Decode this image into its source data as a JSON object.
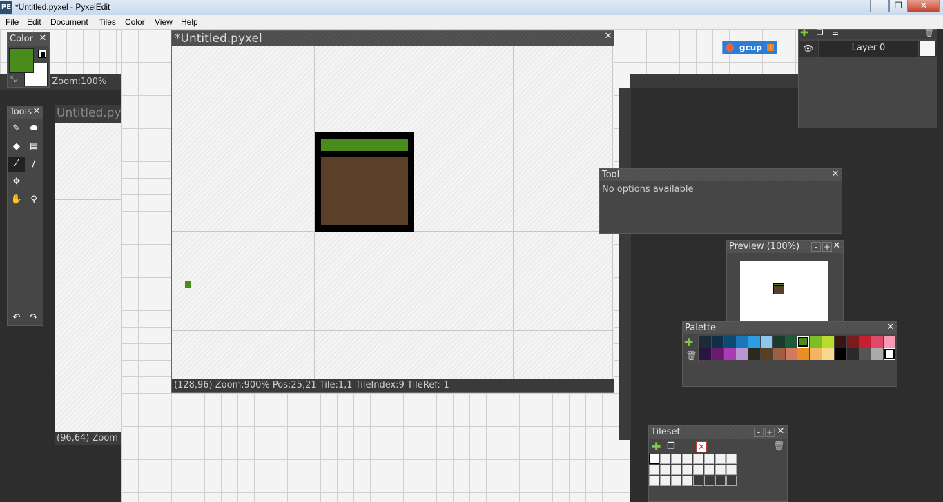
{
  "window": {
    "title": "*Untitled.pyxel - PyxelEdit",
    "logo": "PE",
    "minimize": "—",
    "maximize": "❐",
    "close": "✕"
  },
  "menu": [
    "File",
    "Edit",
    "Document",
    "Tiles",
    "Color",
    "View",
    "Help"
  ],
  "background_doc": {
    "zoom_text": ")  Zoom:100%",
    "status_left": "(96,64)  Zoom",
    "title": "Untitled.pyxel"
  },
  "color_panel": {
    "title": "Color",
    "primary": "#4a8c1c",
    "secondary": "#ffffff",
    "close": "✕"
  },
  "tools_panel": {
    "title": "Tools",
    "close": "✕"
  },
  "document": {
    "title": "*Untitled.pyxel",
    "close": "✕",
    "status": "(128,96)   Zoom:900%   Pos:25,21   Tile:1,1   TileIndex:9   TileRef:-1"
  },
  "layers_panel": {
    "layer_name": "Layer 0"
  },
  "gcup": {
    "label": "gcup",
    "badge": "!"
  },
  "tool_panel": {
    "title": "Tool",
    "message": "No options available",
    "close": "✕"
  },
  "preview_panel": {
    "title": "Preview (100%)",
    "minus": "-",
    "plus": "+",
    "close": "✕"
  },
  "palette_panel": {
    "title": "Palette",
    "close": "✕",
    "row1": [
      "#1d2a3a",
      "#10304a",
      "#0c4a74",
      "#1a78b8",
      "#2d9de4",
      "#8cc8ee",
      "#1a3a2e",
      "#1d5a36",
      "#4a8c1c",
      "#7cbf22",
      "#b8dc2c",
      "#3a1414",
      "#7a1c1c",
      "#c42030",
      "#e0486a",
      "#f49ab4"
    ],
    "row2": [
      "#2a1440",
      "#6a1a6e",
      "#a83cb4",
      "#b896d4",
      "#2a2a1e",
      "#5a3e22",
      "#9e5e42",
      "#d07a60",
      "#e89024",
      "#f4b460",
      "#f8d88c",
      "#000000",
      "#2a2a2a",
      "#555555",
      "#aaaaaa",
      "#ffffff"
    ]
  },
  "tileset_panel": {
    "title": "Tileset",
    "minus": "-",
    "plus": "+",
    "close": "✕"
  }
}
